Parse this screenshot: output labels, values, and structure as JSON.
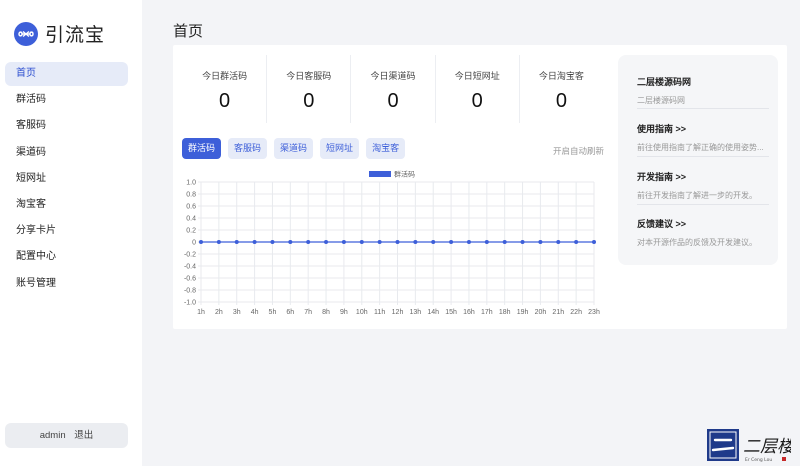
{
  "brand": {
    "name": "引流宝",
    "logo_icon": "infinity-icon",
    "accent": "#3d5fd9"
  },
  "sidebar": {
    "items": [
      {
        "label": "首页",
        "active": true
      },
      {
        "label": "群活码"
      },
      {
        "label": "客服码"
      },
      {
        "label": "渠道码"
      },
      {
        "label": "短网址"
      },
      {
        "label": "淘宝客"
      },
      {
        "label": "分享卡片"
      },
      {
        "label": "配置中心"
      },
      {
        "label": "账号管理"
      }
    ]
  },
  "user": {
    "name": "admin",
    "logout": "退出"
  },
  "page": {
    "title": "首页"
  },
  "stats": [
    {
      "label": "今日群活码",
      "value": "0"
    },
    {
      "label": "今日客服码",
      "value": "0"
    },
    {
      "label": "今日渠道码",
      "value": "0"
    },
    {
      "label": "今日短网址",
      "value": "0"
    },
    {
      "label": "今日淘宝客",
      "value": "0"
    }
  ],
  "tabs": [
    {
      "label": "群活码",
      "active": true
    },
    {
      "label": "客服码"
    },
    {
      "label": "渠道码"
    },
    {
      "label": "短网址"
    },
    {
      "label": "淘宝客"
    }
  ],
  "auto_refresh": "开启自动刷新",
  "chart_data": {
    "type": "line",
    "x": [
      "1h",
      "2h",
      "3h",
      "4h",
      "5h",
      "6h",
      "7h",
      "8h",
      "9h",
      "10h",
      "11h",
      "12h",
      "13h",
      "14h",
      "15h",
      "16h",
      "17h",
      "18h",
      "19h",
      "20h",
      "21h",
      "22h",
      "23h"
    ],
    "series": [
      {
        "name": "群活码",
        "values": [
          0,
          0,
          0,
          0,
          0,
          0,
          0,
          0,
          0,
          0,
          0,
          0,
          0,
          0,
          0,
          0,
          0,
          0,
          0,
          0,
          0,
          0,
          0
        ],
        "color": "#3d5fd9"
      }
    ],
    "ylim": [
      -1.0,
      1.0
    ],
    "yticks": [
      "1.0",
      "0.8",
      "0.6",
      "0.4",
      "0.2",
      "0",
      "-0.2",
      "-0.4",
      "-0.6",
      "-0.8",
      "-1.0"
    ],
    "grid": true,
    "legend": "top-center"
  },
  "side_panel": {
    "items": [
      {
        "title": "二层楼源码网",
        "desc": "二层楼源码网"
      },
      {
        "title": "使用指南 >>",
        "desc": "前往使用指南了解正确的使用姿势..."
      },
      {
        "title": "开发指南 >>",
        "desc": "前往开发指南了解进一步的开发。"
      },
      {
        "title": "反馈建议 >>",
        "desc": "对本开源作品的反馈及开发建议。"
      }
    ]
  },
  "watermark": {
    "text": "二层楼",
    "subtext": "Er Ceng Lou"
  }
}
